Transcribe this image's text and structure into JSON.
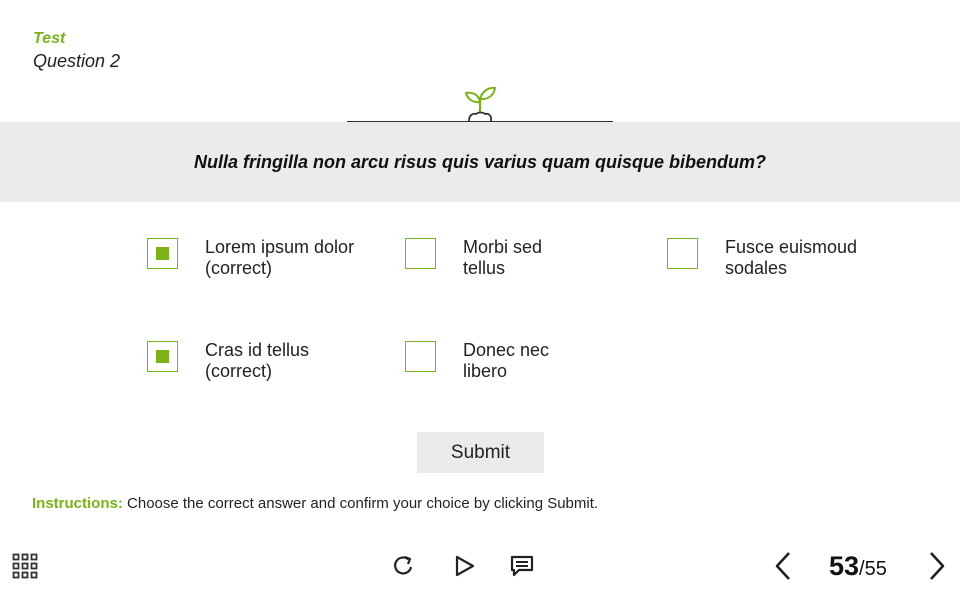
{
  "header": {
    "section": "Test",
    "question_number": "Question 2"
  },
  "question": {
    "text": "Nulla fringilla non arcu risus quis varius quam quisque bibendum?"
  },
  "options": [
    {
      "label": "Lorem ipsum dolor (correct)",
      "checked": true
    },
    {
      "label": "Morbi sed tellus",
      "checked": false
    },
    {
      "label": "Fusce euismoud sodales",
      "checked": false
    },
    {
      "label": "Cras id tellus (correct)",
      "checked": true
    },
    {
      "label": "Donec nec libero",
      "checked": false
    }
  ],
  "submit": {
    "label": "Submit"
  },
  "instructions": {
    "label": "Instructions:",
    "text": "Choose the correct answer and confirm your choice by clicking Submit."
  },
  "footer": {
    "icons": [
      "grid-menu-icon",
      "replay-icon",
      "play-icon",
      "notes-icon",
      "prev-arrow-icon",
      "next-arrow-icon"
    ],
    "page_current": "53",
    "page_total": "/55"
  },
  "colors": {
    "accent": "#7ab317",
    "band": "#ebebeb"
  }
}
